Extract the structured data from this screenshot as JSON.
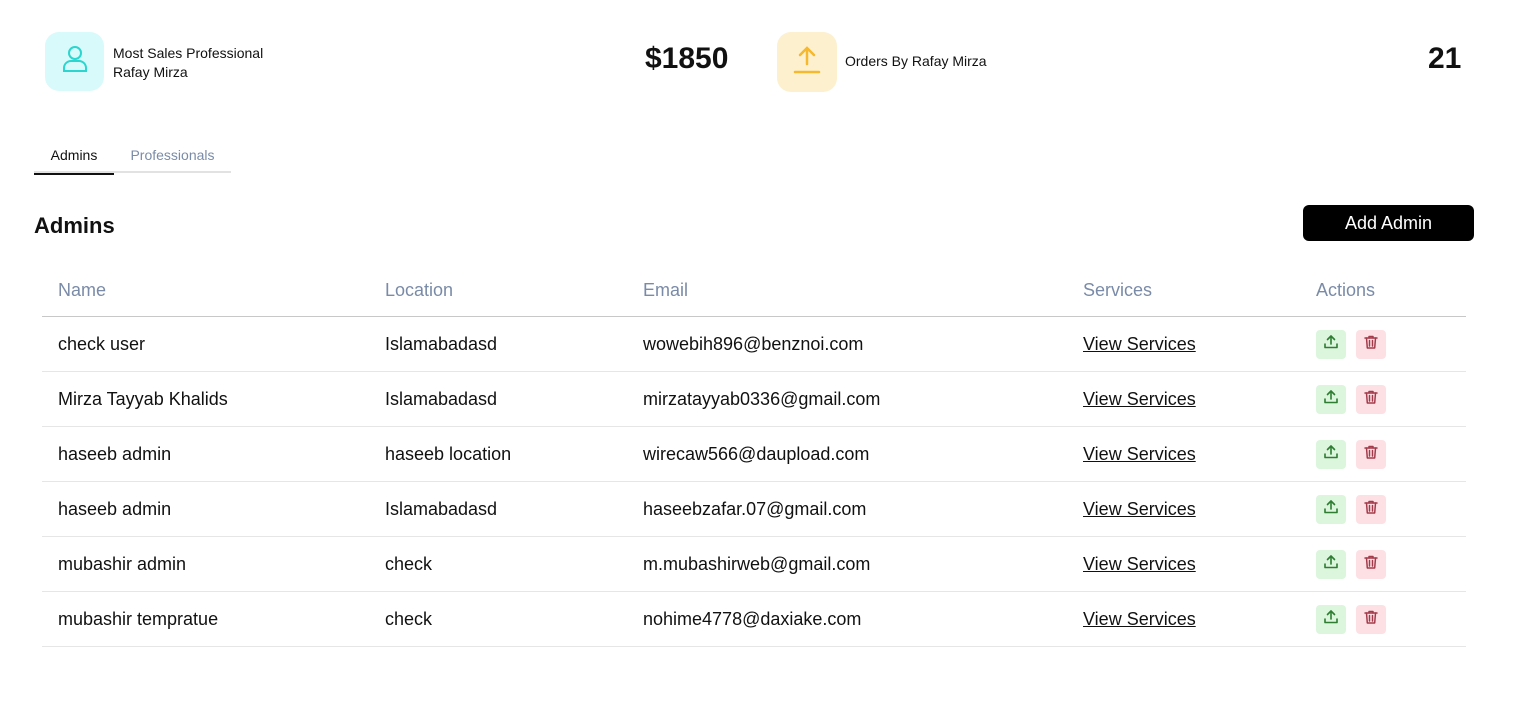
{
  "stats": {
    "professional_label": "Most Sales Professional",
    "professional_name": "Rafay Mirza",
    "sales_amount": "$1850",
    "orders_label": "Orders By Rafay Mirza",
    "orders_count": "21",
    "colors": {
      "avatar_bg": "#d9fafa",
      "avatar_icon": "#2ad6cf",
      "orders_bg": "#fdf0cf",
      "orders_icon": "#f5b82e"
    }
  },
  "tabs": [
    {
      "label": "Admins",
      "active": true
    },
    {
      "label": "Professionals",
      "active": false
    }
  ],
  "section": {
    "title": "Admins",
    "add_button": "Add Admin"
  },
  "table": {
    "headers": [
      "Name",
      "Location",
      "Email",
      "Services",
      "Actions"
    ],
    "rows": [
      {
        "name": "check user",
        "location": "Islamabadasd",
        "email": "wowebih896@benznoi.com",
        "services": "View Services"
      },
      {
        "name": "Mirza Tayyab Khalids",
        "location": "Islamabadasd",
        "email": "mirzatayyab0336@gmail.com",
        "services": "View Services"
      },
      {
        "name": "haseeb admin",
        "location": "haseeb location",
        "email": "wirecaw566@daupload.com",
        "services": "View Services"
      },
      {
        "name": "haseeb admin",
        "location": "Islamabadasd",
        "email": "haseebzafar.07@gmail.com",
        "services": "View Services"
      },
      {
        "name": "mubashir admin",
        "location": "check",
        "email": "m.mubashirweb@gmail.com",
        "services": "View Services"
      },
      {
        "name": "mubashir tempratue",
        "location": "check",
        "email": "nohime4778@daxiake.com",
        "services": "View Services"
      }
    ],
    "action_icons": [
      "upload-icon",
      "trash-icon"
    ],
    "colors": {
      "header_text": "#7a8ba8",
      "upload_bg": "#dcf5dd",
      "upload_icon": "#2e7d32",
      "delete_bg": "#fde0e4",
      "delete_icon": "#a33a4a"
    }
  }
}
